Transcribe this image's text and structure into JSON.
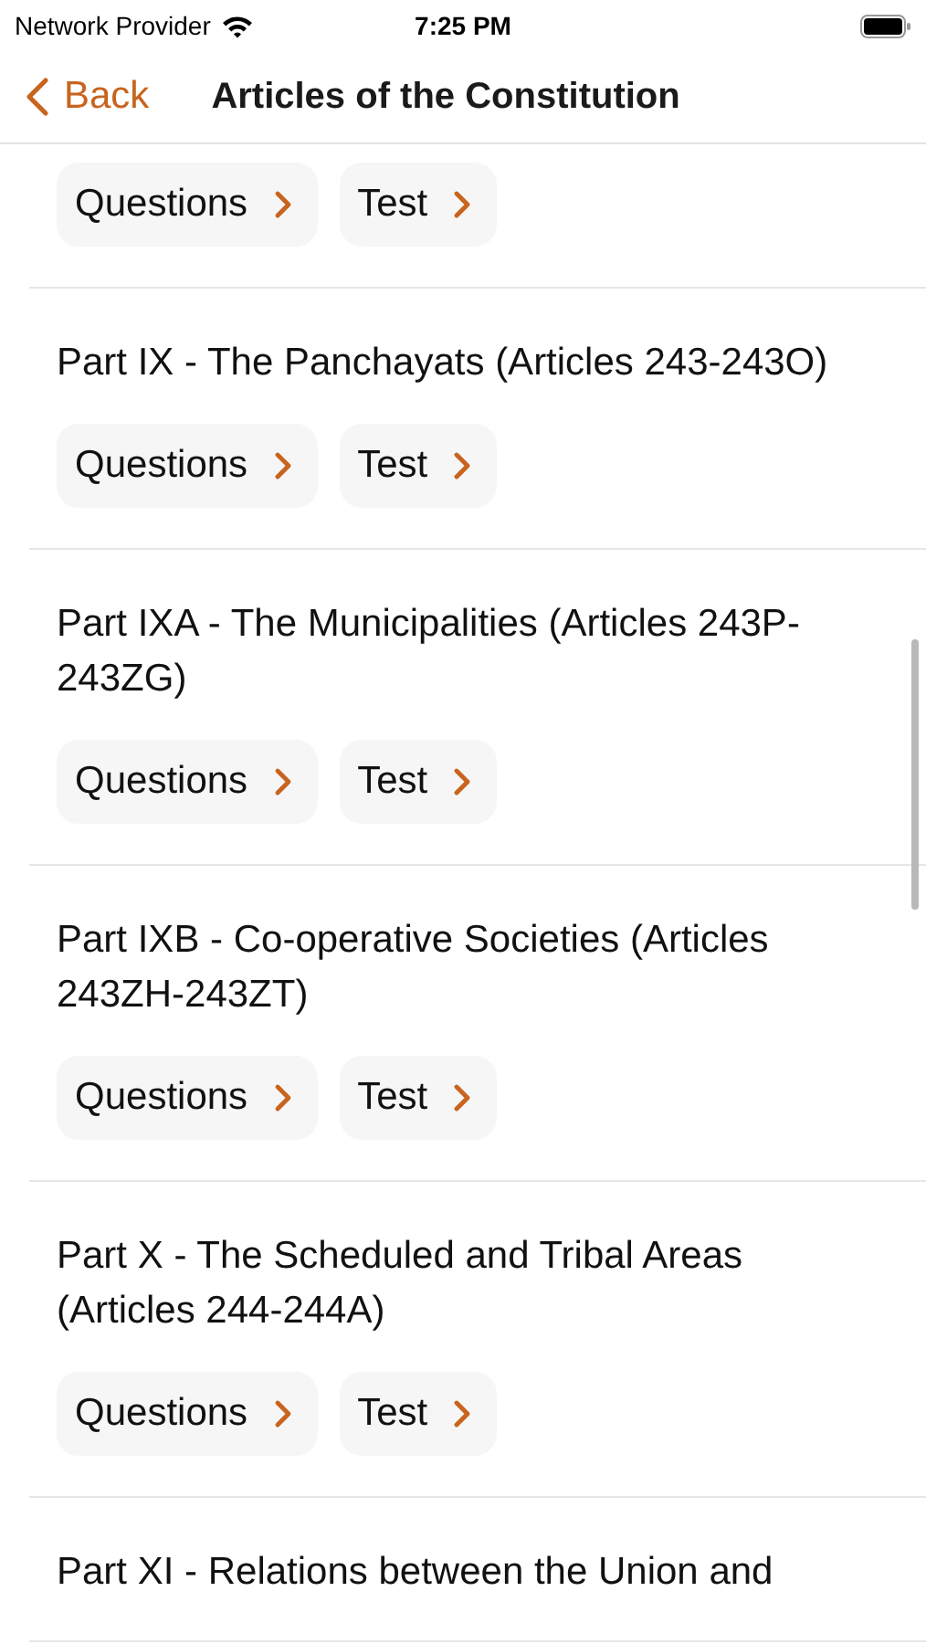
{
  "status_bar": {
    "carrier": "Network Provider",
    "time": "7:25 PM"
  },
  "nav": {
    "back": "Back",
    "title": "Articles of the Constitution"
  },
  "sections": [
    {
      "buttons": [
        "Questions",
        "Test"
      ]
    },
    {
      "title": "Part IX - The Panchayats (Articles 243-243O)",
      "buttons": [
        "Questions",
        "Test"
      ]
    },
    {
      "title": "Part IXA - The Municipalities (Articles 243P-243ZG)",
      "buttons": [
        "Questions",
        "Test"
      ]
    },
    {
      "title": "Part IXB - Co-operative Societies (Articles 243ZH-243ZT)",
      "buttons": [
        "Questions",
        "Test"
      ]
    },
    {
      "title": "Part X - The Scheduled and Tribal Areas (Articles 244-244A)",
      "buttons": [
        "Questions",
        "Test"
      ]
    },
    {
      "title": "Part XI - Relations between the Union and"
    }
  ]
}
